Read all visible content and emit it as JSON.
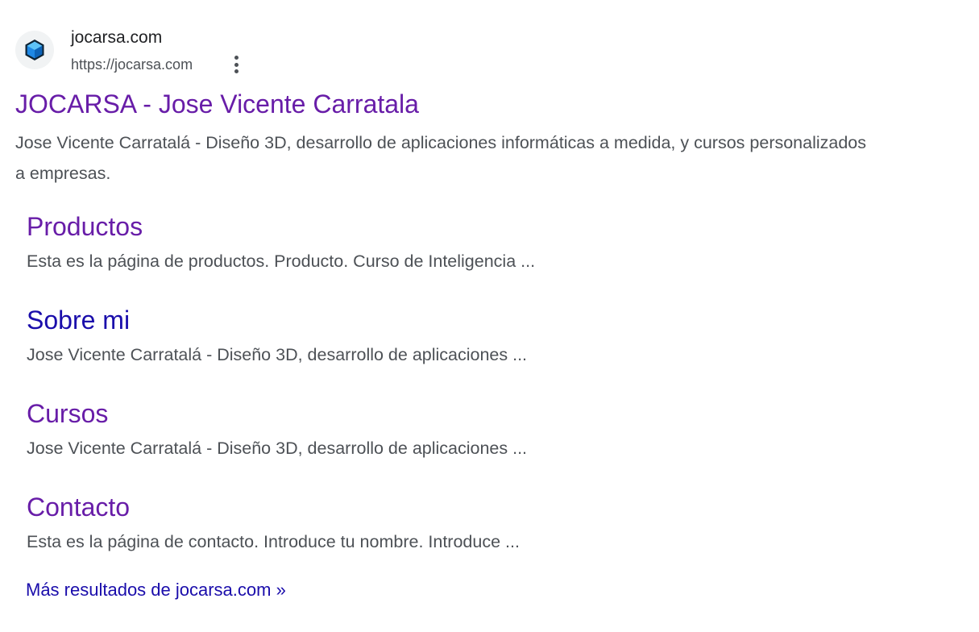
{
  "result": {
    "site_name": "jocarsa.com",
    "site_url": "https://jocarsa.com",
    "favicon_icon": "blue-cube-icon",
    "more_options_icon": "three-dots-vertical-icon",
    "title": "JOCARSA - Jose Vicente Carratala",
    "snippet": "Jose Vicente Carratalá - Diseño 3D, desarrollo de aplicaciones informáticas a medida, y cursos personalizados a empresas."
  },
  "sitelinks": [
    {
      "title": "Productos",
      "snippet": "Esta es la página de productos. Producto. Curso de Inteligencia ...",
      "color": "#681da8"
    },
    {
      "title": "Sobre mi",
      "snippet": "Jose Vicente Carratalá - Diseño 3D, desarrollo de aplicaciones ...",
      "color": "#1a0dab"
    },
    {
      "title": "Cursos",
      "snippet": "Jose Vicente Carratalá - Diseño 3D, desarrollo de aplicaciones ...",
      "color": "#681da8"
    },
    {
      "title": "Contacto",
      "snippet": "Esta es la página de contacto. Introduce tu nombre. Introduce ...",
      "color": "#681da8"
    }
  ],
  "more_results_label": "Más resultados de jocarsa.com »",
  "colors": {
    "visited_link": "#681da8",
    "unvisited_link": "#1a0dab",
    "snippet_text": "#4d5156",
    "site_name_text": "#202124"
  }
}
